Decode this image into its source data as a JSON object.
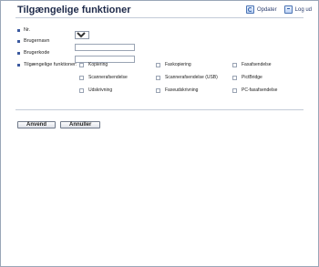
{
  "header": {
    "title": "Tilgængelige funktioner",
    "refresh_label": "Opdater",
    "logout_label": "Log ud"
  },
  "form": {
    "nr_label": "Nr.",
    "nr_value": "1",
    "username_label": "Brugernavn",
    "username_value": "",
    "usercode_label": "Brugerkode",
    "usercode_value": "",
    "functions_label": "Tilgængelige funktioner:",
    "functions": [
      "Kopiering",
      "Faxkopiering",
      "Faxafsendelse",
      "Scannerafsendelse",
      "Scannerafsendelse (USB)",
      "PictBridge",
      "Udskrivning",
      "Faxeudskrivning",
      "PC-faxafsendelse"
    ]
  },
  "buttons": {
    "apply_label": "Anvend",
    "cancel_label": "Annuller"
  },
  "colors": {
    "accent": "#3c5aa0",
    "border": "#9aa6b8",
    "title": "#1e2a4a"
  }
}
